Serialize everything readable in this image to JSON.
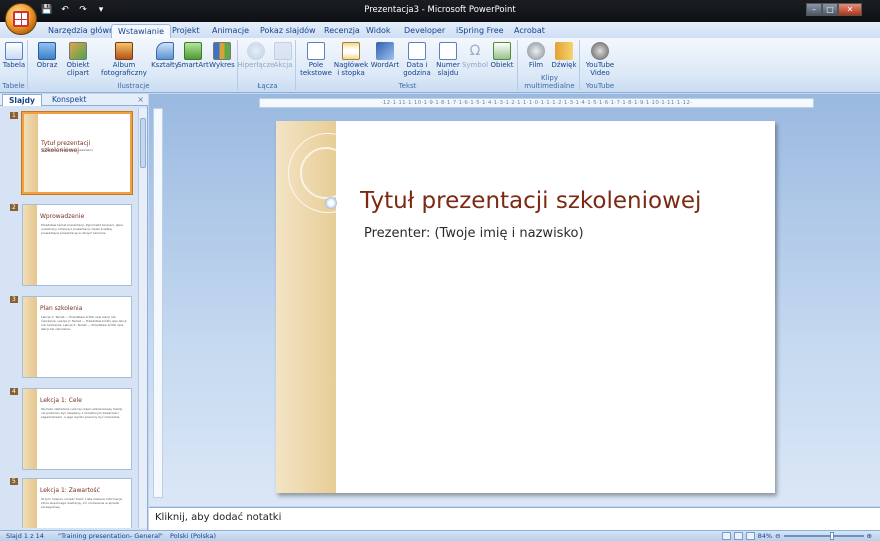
{
  "window": {
    "title": "Prezentacja3 - Microsoft PowerPoint"
  },
  "tabs": [
    "Narzędzia główne",
    "Wstawianie",
    "Projekt",
    "Animacje",
    "Pokaz slajdów",
    "Recenzja",
    "Widok",
    "Developer",
    "iSpring Free",
    "Acrobat"
  ],
  "active_tab": "Wstawianie",
  "ribbon": {
    "groups": [
      {
        "label": "Tabele",
        "buttons": [
          {
            "label": "Tabela",
            "icon": "table-icon"
          }
        ]
      },
      {
        "label": "Ilustracje",
        "buttons": [
          {
            "label": "Obraz",
            "icon": "picture-icon"
          },
          {
            "label": "Obiekt clipart",
            "icon": "clipart-icon"
          },
          {
            "label": "Album fotograficzny",
            "icon": "photo-album-icon"
          },
          {
            "label": "Kształty",
            "icon": "shapes-icon"
          },
          {
            "label": "SmartArt",
            "icon": "smartart-icon"
          },
          {
            "label": "Wykres",
            "icon": "chart-icon"
          }
        ]
      },
      {
        "label": "Łącza",
        "buttons": [
          {
            "label": "Hiperłącze",
            "icon": "hyperlink-icon",
            "disabled": true
          },
          {
            "label": "Akcja",
            "icon": "action-icon",
            "disabled": true
          }
        ]
      },
      {
        "label": "Tekst",
        "buttons": [
          {
            "label": "Pole tekstowe",
            "icon": "textbox-icon"
          },
          {
            "label": "Nagłówek i stopka",
            "icon": "header-footer-icon"
          },
          {
            "label": "WordArt",
            "icon": "wordart-icon"
          },
          {
            "label": "Data i godzina",
            "icon": "date-time-icon"
          },
          {
            "label": "Numer slajdu",
            "icon": "slide-number-icon",
            "disabled": true
          },
          {
            "label": "Symbol",
            "icon": "symbol-icon",
            "disabled": true
          },
          {
            "label": "Obiekt",
            "icon": "object-icon"
          }
        ]
      },
      {
        "label": "Klipy multimedialne",
        "buttons": [
          {
            "label": "Film",
            "icon": "film-icon"
          },
          {
            "label": "Dźwięk",
            "icon": "sound-icon"
          }
        ]
      },
      {
        "label": "YouTube",
        "buttons": [
          {
            "label": "YouTube Video",
            "icon": "youtube-icon"
          }
        ]
      }
    ]
  },
  "panel": {
    "tabs": [
      "Slajdy",
      "Konspekt"
    ],
    "active": "Slajdy",
    "close": "×"
  },
  "slides": [
    {
      "num": "1",
      "title": "Tytuł prezentacji szkoleniowej",
      "text": "Prezenter: (Twoje imię i nazwisko)",
      "selected": true
    },
    {
      "num": "2",
      "title": "Wprowadzenie",
      "text": "Przedstaw temat prezentacji. Zgromadź korzyści, jakie uczestnicy odniosą z prezentacji. Opisz ścieżkę prowadzącą prezentację w danym temacie."
    },
    {
      "num": "3",
      "title": "Plan szkolenia",
      "text": "Lekcja 1: Temat — Przedstaw krótki opis lekcji lub ćwiczenia. Lekcja 2: Temat — Przedstaw krótki opis lekcji lub ćwiczenia. Lekcja 3: Temat — Przedstaw krótki opis lekcji lub ćwiczenia."
    },
    {
      "num": "4",
      "title": "Lekcja 1: Cele",
      "text": "Wymień zakładane cele tej części szkoleniowej. Każdy cel powinien być związany z określonym zawartości zagadnieniem, a jego wyniki powinny być mierzalne."
    },
    {
      "num": "5",
      "title": "Lekcja 1: Zawartość",
      "text": "W tym miejscu umieść treść. Lista zawiera informacje, która wspomaga ilustrację, ich omówienie w sposób szczegółowy."
    }
  ],
  "ruler": "·12·1·11·1·10·1·9·1·8·1·7·1·6·1·5·1·4·1·3·1·2·1·1·1·0·1·1·1·2·1·3·1·4·1·5·1·6·1·7·1·8·1·9·1·10·1·11·1·12·",
  "current_slide": {
    "title": "Tytuł prezentacji szkoleniowej",
    "subtitle": "Prezenter: (Twoje imię i nazwisko)"
  },
  "notes": {
    "placeholder": "Kliknij, aby dodać notatki"
  },
  "status": {
    "slide": "Slajd 1 z 14",
    "theme": "\"Training presentation- General\"",
    "language": "Polski (Polska)",
    "zoom": "84%"
  }
}
